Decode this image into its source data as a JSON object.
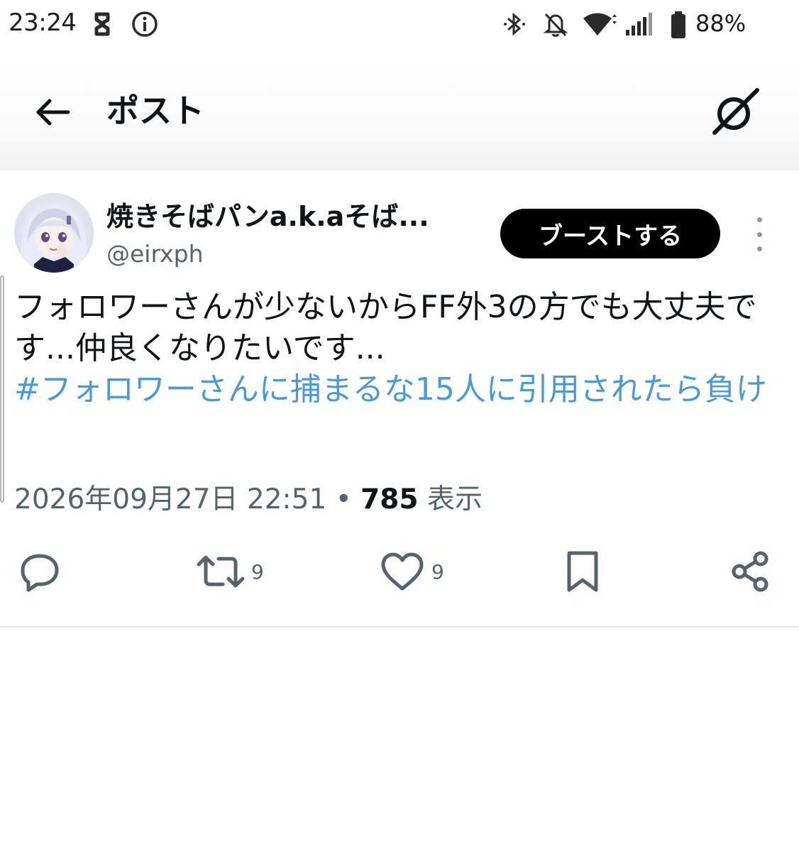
{
  "status_bar": {
    "time": "23:24",
    "battery": "88%",
    "icons": [
      "sync-icon",
      "info-icon",
      "bluetooth-icon",
      "mute-icon",
      "wifi-icon",
      "signal-icon",
      "battery-icon"
    ]
  },
  "header": {
    "title": "ポスト",
    "back_icon": "arrow-left-icon",
    "grok_icon": "grok-icon"
  },
  "post": {
    "display_name": "焼きそばパンa.k.aそば...",
    "handle": "@eirxph",
    "boost_label": "ブーストする",
    "text": "フォロワーさんが少ないからFF外3の方でも大丈夫です...仲良くなりたいです...",
    "hashtag": "#フォロワーさんに捕まるな15人に引用されたら負け",
    "timestamp": "2026年09月27日 22:51",
    "separator": "•",
    "views_count": "785",
    "views_label": "表示"
  },
  "actions": {
    "reply_count": "",
    "repost_count": "9",
    "like_count": "9"
  },
  "colors": {
    "accent_link": "#4a9ad8",
    "text_primary": "#0f1419",
    "text_secondary": "#536471",
    "boost_bg": "#000000"
  }
}
